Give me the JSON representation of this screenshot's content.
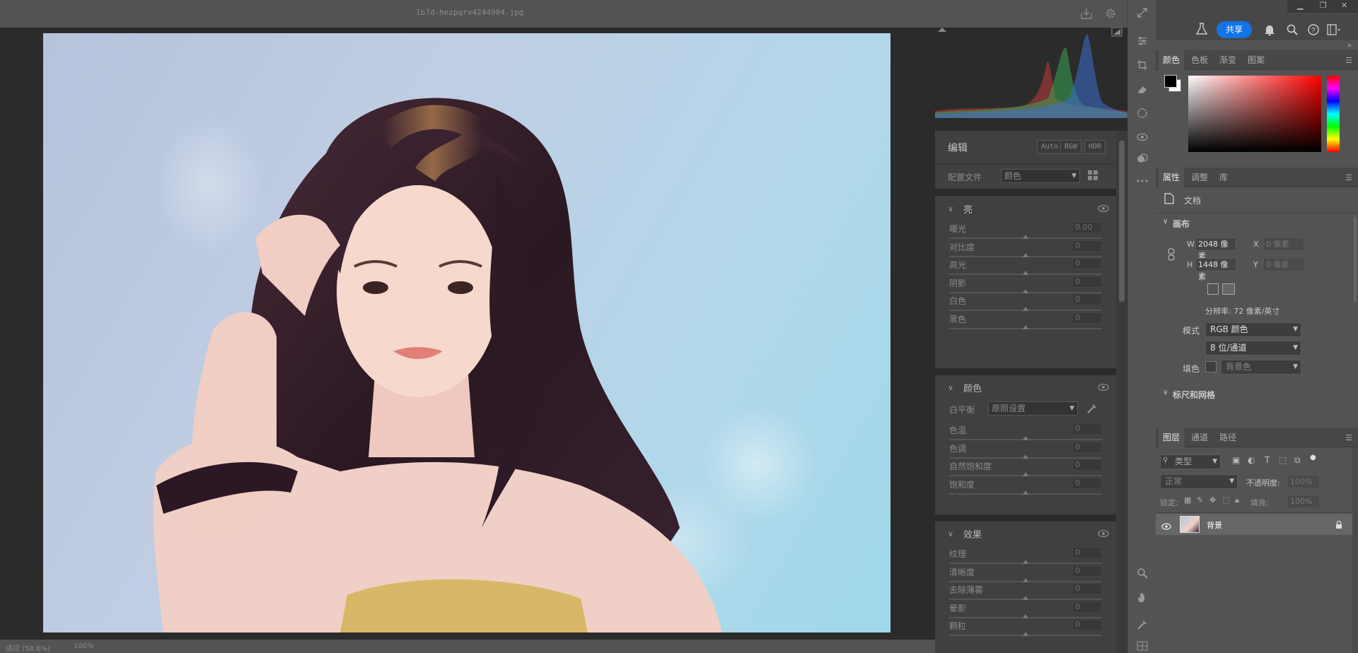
{
  "camera_raw": {
    "filename": "1b7d-hezpqrx4244904.jpg",
    "status_left": "适应 (58.6%)",
    "zoom": "100%",
    "edit_title": "编辑",
    "profile_buttons": [
      "Auto",
      "B&W",
      "HDR"
    ],
    "profile_label": "配置文件",
    "profile_value": "颜色",
    "light": {
      "title": "亮",
      "sliders": [
        {
          "label": "曝光",
          "value": "0.00"
        },
        {
          "label": "对比度",
          "value": "0"
        },
        {
          "label": "高光",
          "value": "0"
        },
        {
          "label": "阴影",
          "value": "0"
        },
        {
          "label": "白色",
          "value": "0"
        },
        {
          "label": "黑色",
          "value": "0"
        }
      ]
    },
    "color": {
      "title": "颜色",
      "wb_label": "白平衡",
      "wb_value": "原照设置",
      "sliders": [
        {
          "label": "色温",
          "value": "0"
        },
        {
          "label": "色调",
          "value": "0"
        },
        {
          "label": "自然饱和度",
          "value": "0"
        },
        {
          "label": "饱和度",
          "value": "0"
        }
      ]
    },
    "effects": {
      "title": "效果",
      "sliders": [
        {
          "label": "纹理",
          "value": "0"
        },
        {
          "label": "清晰度",
          "value": "0"
        },
        {
          "label": "去除薄雾",
          "value": "0"
        },
        {
          "label": "晕影",
          "value": "0"
        },
        {
          "label": "颗粒",
          "value": "0"
        }
      ]
    }
  },
  "photoshop": {
    "share_label": "共享",
    "color_tabs": [
      "颜色",
      "色板",
      "渐变",
      "图案"
    ],
    "props_tabs": [
      "属性",
      "调整",
      "库"
    ],
    "doc_label": "文档",
    "canvas_section": "画布",
    "width_label": "W",
    "width_value": "2048 像素",
    "height_label": "H",
    "height_value": "1448 像素",
    "x_label": "X",
    "x_placeholder": "0 像素",
    "y_label": "Y",
    "y_placeholder": "0 像素",
    "resolution": "分辨率: 72 像素/英寸",
    "mode_label": "模式",
    "mode_value": "RGB 颜色",
    "depth_value": "8 位/通道",
    "fill_label": "填色",
    "fill_value": "背景色",
    "rulers_section": "标尺和网格",
    "layers_tabs": [
      "图层",
      "通道",
      "路径"
    ],
    "layer_filter": "类型",
    "blend_mode": "正常",
    "opacity_label": "不透明度:",
    "opacity_value": "100%",
    "lock_label": "锁定:",
    "fill_label2": "填充:",
    "fill_pct": "100%",
    "layer_name": "背景"
  },
  "colors": {
    "accent": "#1473e6",
    "panel_bg": "#535353",
    "dark_bg": "#2b2b2b"
  }
}
